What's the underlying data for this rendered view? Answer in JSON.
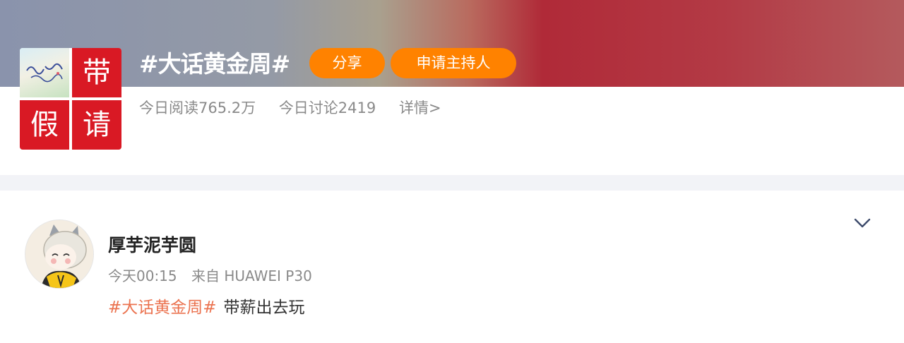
{
  "topic": {
    "title": "#大话黄金周#",
    "share_label": "分享",
    "host_label": "申请主持人",
    "reads": "今日阅读765.2万",
    "discussions": "今日讨论2419",
    "details_label": "详情>",
    "cover": {
      "char_tr": "带",
      "char_bl": "假",
      "char_br": "请"
    }
  },
  "post": {
    "username": "厚芋泥芋圆",
    "time": "今天00:15",
    "source": "来自 HUAWEI P30",
    "hashtag": "#大话黄金周#",
    "text": "带薪出去玩"
  },
  "icons": {
    "expand": "chevron-down-icon"
  },
  "colors": {
    "accent_orange": "#ff8200",
    "hashtag": "#eb7350",
    "cover_red": "#d91924"
  }
}
